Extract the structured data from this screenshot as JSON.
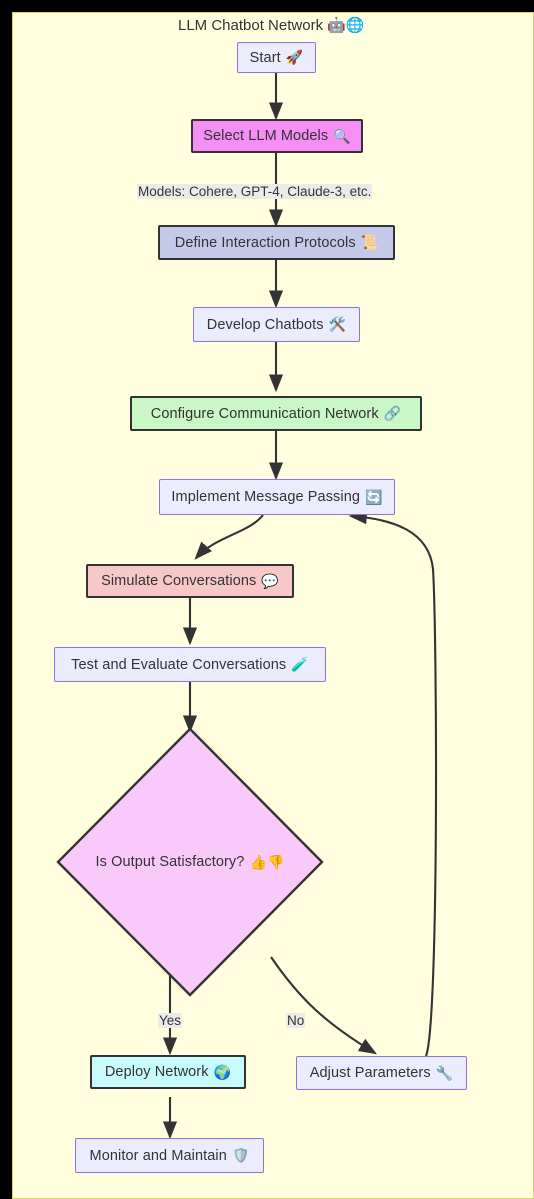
{
  "diagram": {
    "type": "flowchart",
    "direction": "top-down",
    "title": "LLM Chatbot Network 🤖🌐",
    "background_color": "#ffffe0",
    "frame_color": "#000000",
    "nodes": [
      {
        "id": "start",
        "label": "Start",
        "emoji": "🚀",
        "shape": "rect",
        "fill": "#ECECFF",
        "stroke": "#9370DB"
      },
      {
        "id": "select",
        "label": "Select LLM Models",
        "emoji": "🔍",
        "shape": "rect",
        "fill": "#f58ef5",
        "stroke": "#333333"
      },
      {
        "id": "protocols",
        "label": "Define Interaction Protocols",
        "emoji": "📜",
        "shape": "rect",
        "fill": "#c5cae9",
        "stroke": "#333333"
      },
      {
        "id": "develop",
        "label": "Develop Chatbots",
        "emoji": "🛠️",
        "shape": "rect",
        "fill": "#ECECFF",
        "stroke": "#9370DB"
      },
      {
        "id": "configure",
        "label": "Configure Communication Network",
        "emoji": "🔗",
        "shape": "rect",
        "fill": "#c9f7c5",
        "stroke": "#333333"
      },
      {
        "id": "messaging",
        "label": "Implement Message Passing",
        "emoji": "🔄",
        "shape": "rect",
        "fill": "#ECECFF",
        "stroke": "#9370DB"
      },
      {
        "id": "simulate",
        "label": "Simulate Conversations",
        "emoji": "💬",
        "shape": "rect",
        "fill": "#f8c8c8",
        "stroke": "#333333"
      },
      {
        "id": "test",
        "label": "Test and Evaluate Conversations",
        "emoji": "🧪",
        "shape": "rect",
        "fill": "#ECECFF",
        "stroke": "#9370DB"
      },
      {
        "id": "decision",
        "label": "Is Output Satisfactory?",
        "emoji": "👍👎",
        "shape": "diamond",
        "fill": "#f9c9f9",
        "stroke": "#333333"
      },
      {
        "id": "deploy",
        "label": "Deploy Network",
        "emoji": "🌍",
        "shape": "rect",
        "fill": "#c8fbfb",
        "stroke": "#333333"
      },
      {
        "id": "adjust",
        "label": "Adjust Parameters",
        "emoji": "🔧",
        "shape": "rect",
        "fill": "#ECECFF",
        "stroke": "#9370DB"
      },
      {
        "id": "monitor",
        "label": "Monitor and Maintain",
        "emoji": "🛡️",
        "shape": "rect",
        "fill": "#ECECFF",
        "stroke": "#9370DB"
      }
    ],
    "edges": [
      {
        "from": "start",
        "to": "select",
        "label": ""
      },
      {
        "from": "select",
        "to": "protocols",
        "label": "Models: Cohere, GPT-4, Claude-3, etc."
      },
      {
        "from": "protocols",
        "to": "develop",
        "label": ""
      },
      {
        "from": "develop",
        "to": "configure",
        "label": ""
      },
      {
        "from": "configure",
        "to": "messaging",
        "label": ""
      },
      {
        "from": "messaging",
        "to": "simulate",
        "label": ""
      },
      {
        "from": "simulate",
        "to": "test",
        "label": ""
      },
      {
        "from": "test",
        "to": "decision",
        "label": ""
      },
      {
        "from": "decision",
        "to": "deploy",
        "label": "Yes"
      },
      {
        "from": "decision",
        "to": "adjust",
        "label": "No"
      },
      {
        "from": "adjust",
        "to": "messaging",
        "label": ""
      },
      {
        "from": "deploy",
        "to": "monitor",
        "label": ""
      }
    ]
  }
}
